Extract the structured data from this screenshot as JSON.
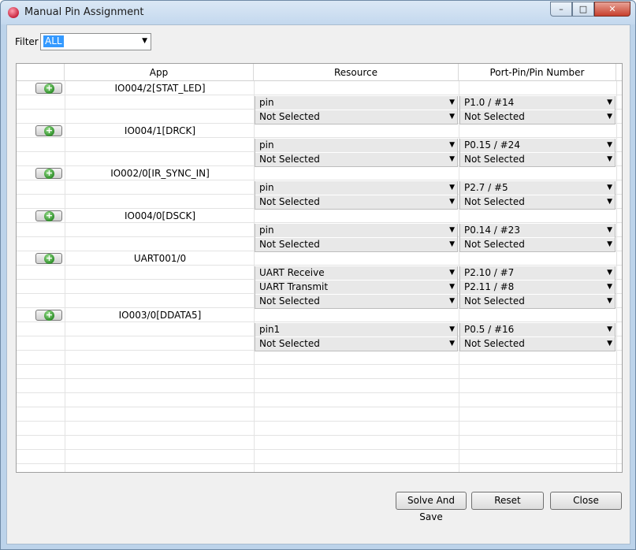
{
  "window": {
    "title": "Manual Pin Assignment"
  },
  "filter": {
    "label": "Filter",
    "value": "ALL"
  },
  "table": {
    "headers": [
      "App",
      "Resource",
      "Port-Pin/Pin Number"
    ],
    "apps": [
      {
        "name": "IO004/2[STAT_LED]",
        "rows": [
          {
            "resource": "pin",
            "pin": "P1.0 / #14"
          },
          {
            "resource": "Not Selected",
            "pin": "Not Selected"
          }
        ]
      },
      {
        "name": "IO004/1[DRCK]",
        "rows": [
          {
            "resource": "pin",
            "pin": "P0.15 / #24"
          },
          {
            "resource": "Not Selected",
            "pin": "Not Selected"
          }
        ]
      },
      {
        "name": "IO002/0[IR_SYNC_IN]",
        "rows": [
          {
            "resource": "pin",
            "pin": "P2.7 / #5"
          },
          {
            "resource": "Not Selected",
            "pin": "Not Selected"
          }
        ]
      },
      {
        "name": "IO004/0[DSCK]",
        "rows": [
          {
            "resource": "pin",
            "pin": "P0.14 / #23"
          },
          {
            "resource": "Not Selected",
            "pin": "Not Selected"
          }
        ]
      },
      {
        "name": "UART001/0",
        "rows": [
          {
            "resource": "UART Receive",
            "pin": "P2.10 / #7"
          },
          {
            "resource": "UART Transmit",
            "pin": "P2.11 / #8"
          },
          {
            "resource": "Not Selected",
            "pin": "Not Selected"
          }
        ]
      },
      {
        "name": "IO003/0[DDATA5]",
        "rows": [
          {
            "resource": "pin1",
            "pin": "P0.5 / #16"
          },
          {
            "resource": "Not Selected",
            "pin": "Not Selected"
          }
        ]
      }
    ]
  },
  "buttons": {
    "solve": "Solve And Save",
    "reset": "Reset",
    "close": "Close"
  },
  "icons": {
    "app": "app-icon",
    "add": "plus-icon",
    "dropdown": "chevron-down-icon"
  },
  "colors": {
    "selection": "#3399ff",
    "add_icon": "#2f8f2a"
  }
}
